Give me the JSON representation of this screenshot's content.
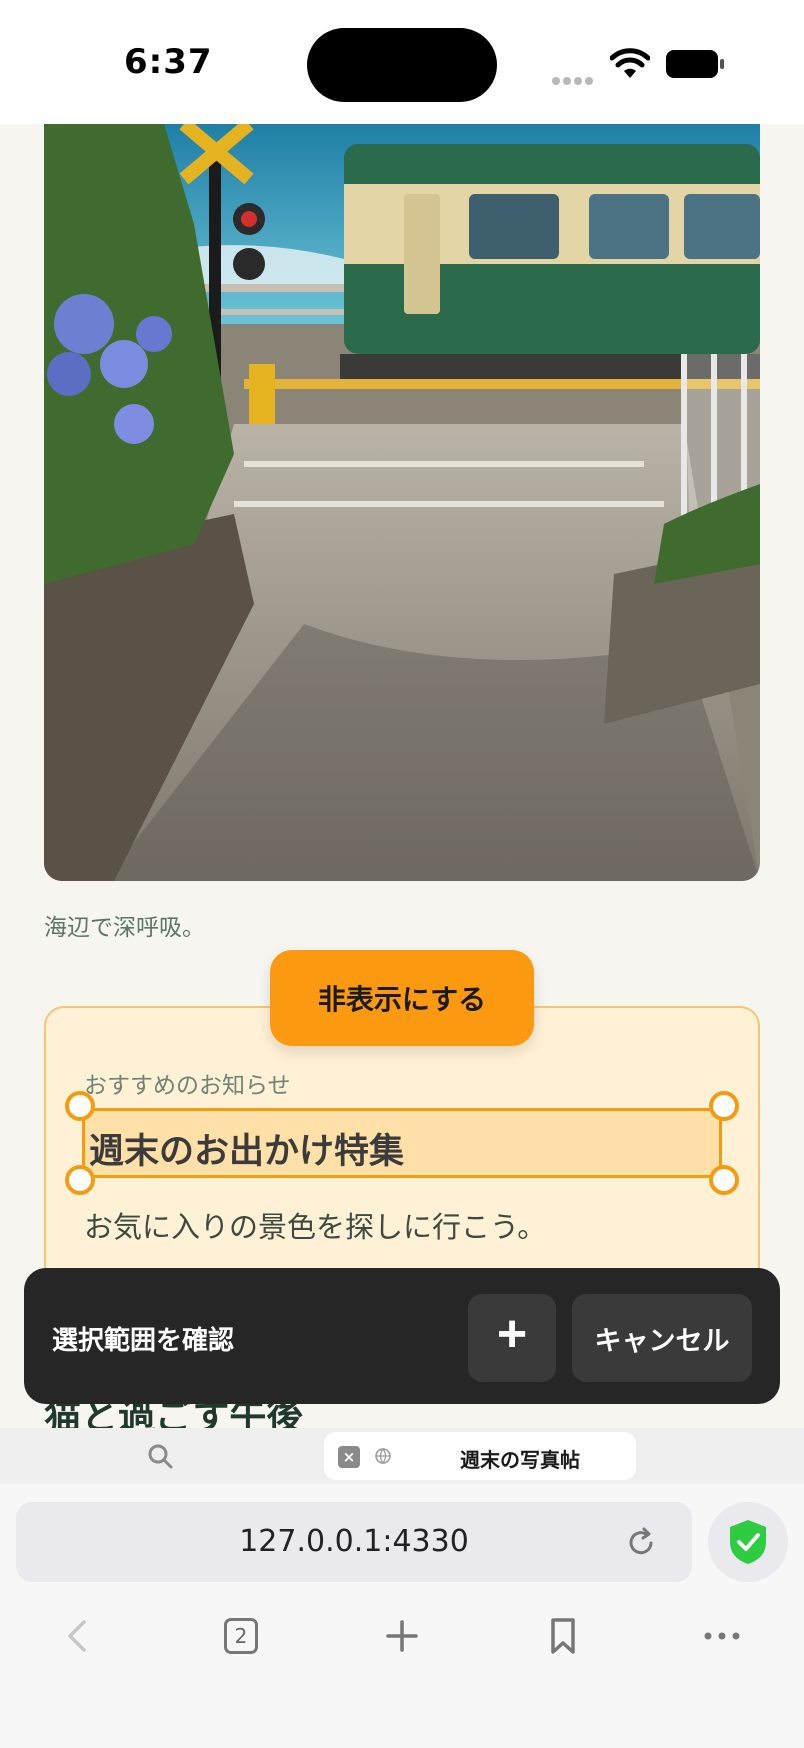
{
  "status_bar": {
    "time": "6:37",
    "icons": [
      "signal-dots-icon",
      "wifi-icon",
      "battery-icon"
    ]
  },
  "article": {
    "photo_alt": "railway-crossing-photo",
    "caption": "海辺で深呼吸。",
    "card": {
      "kicker": "おすすめのお知らせ",
      "title": "週末のお出かけ特集",
      "body": "お気に入りの景色を探しに行こう。"
    },
    "next_heading": "猫と過ごす午後"
  },
  "actions": {
    "hide_label": "非表示にする",
    "confirm_text": "選択範囲を確認",
    "plus_label": "+",
    "cancel_label": "キャンセル"
  },
  "browser": {
    "tab_title": "週末の写真帖",
    "url": "127.0.0.1:4330",
    "tab_count": "2"
  },
  "colors": {
    "accent": "#fb9a10",
    "selection_border": "#f39c12",
    "card_bg": "#fff1d6",
    "confirm_bar": "#262626",
    "shield": "#2ecc40"
  }
}
